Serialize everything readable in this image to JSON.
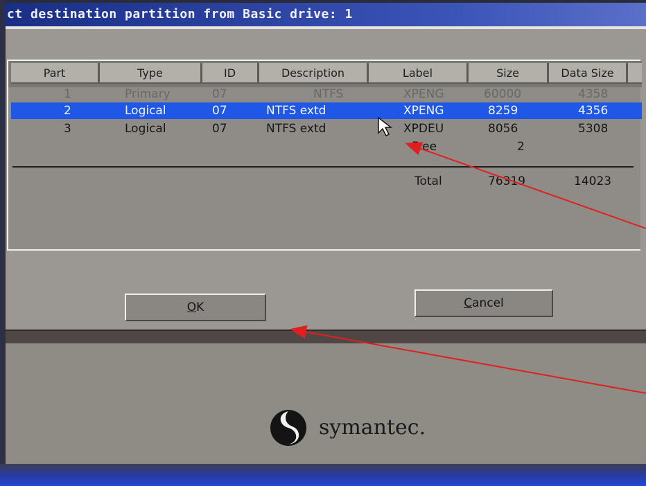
{
  "window": {
    "title": "ct destination partition from Basic drive: 1"
  },
  "table": {
    "headers": [
      "Part",
      "Type",
      "ID",
      "Description",
      "Label",
      "Size",
      "Data Size"
    ],
    "rows": [
      {
        "part": "1",
        "type": "Primary",
        "id": "07",
        "description": "NTFS",
        "label": "XPENG",
        "size": "60000",
        "data_size": "4358",
        "state": "dimmed"
      },
      {
        "part": "2",
        "type": "Logical",
        "id": "07",
        "description": "NTFS extd",
        "label": "XPENG",
        "size": "8259",
        "data_size": "4356",
        "state": "selected"
      },
      {
        "part": "3",
        "type": "Logical",
        "id": "07",
        "description": "NTFS extd",
        "label": "XPDEU",
        "size": "8056",
        "data_size": "5308",
        "state": "normal"
      }
    ],
    "free_row": {
      "label": "Free",
      "size": "2"
    },
    "total_row": {
      "label": "Total",
      "size": "76319",
      "data_size": "14023"
    }
  },
  "buttons": {
    "ok": {
      "mnemonic": "O",
      "rest": "K"
    },
    "cancel": {
      "mnemonic": "C",
      "rest": "ancel"
    }
  },
  "brand": {
    "name": "symantec."
  },
  "colors": {
    "title_bar": "#1a2e86",
    "selection": "#1f57e6",
    "dialog_bg": "#9b9893",
    "annotation_arrow": "#e02020"
  },
  "icons": {
    "cursor": "mouse-pointer-icon",
    "logo": "symantec-logo-icon"
  }
}
